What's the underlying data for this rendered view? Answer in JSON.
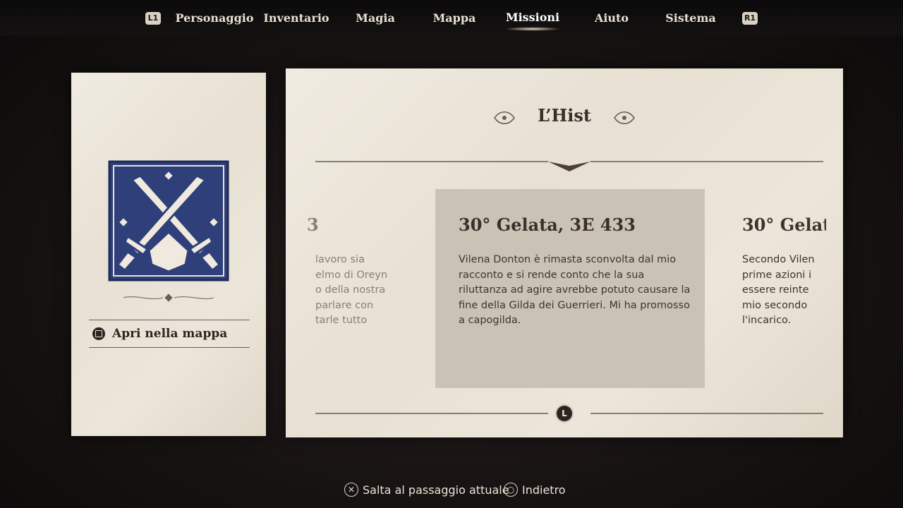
{
  "nav": {
    "left_shoulder": "L1",
    "right_shoulder": "R1",
    "tabs": [
      {
        "label": "Personaggio"
      },
      {
        "label": "Inventario"
      },
      {
        "label": "Magia"
      },
      {
        "label": "Mappa"
      },
      {
        "label": "Missioni",
        "active": true
      },
      {
        "label": "Aiuto"
      },
      {
        "label": "Sistema"
      }
    ]
  },
  "quest": {
    "icon": "crossed-swords-emblem",
    "open_map_label": "Apri nella mappa",
    "title": "L’Hist"
  },
  "entries": {
    "prev": {
      "date_fragment": "3",
      "lines": [
        "lavoro sia",
        "elmo di Oreyn",
        "o della nostra",
        "parlare con",
        "tarle tutto"
      ]
    },
    "current": {
      "date": "30° Gelata, 3E 433",
      "text": "Vilena Donton è rimasta sconvolta dal mio racconto e si rende conto che la sua riluttanza ad agire avrebbe potuto causare la fine della Gilda dei Guerrieri. Mi ha promosso a capogilda."
    },
    "next": {
      "date_fragment": "30° Gelat",
      "lines": [
        "Secondo Vilen",
        "prime azioni i",
        "essere reinte",
        "mio secondo",
        "l'incarico."
      ]
    }
  },
  "scroll_button": "L",
  "hints": {
    "skip": "Salta al passaggio attuale",
    "back": "Indietro"
  },
  "colors": {
    "paper": "#ece6da",
    "emblem_blue": "#2e3f7a",
    "active_entry": "#cbc2b6"
  }
}
